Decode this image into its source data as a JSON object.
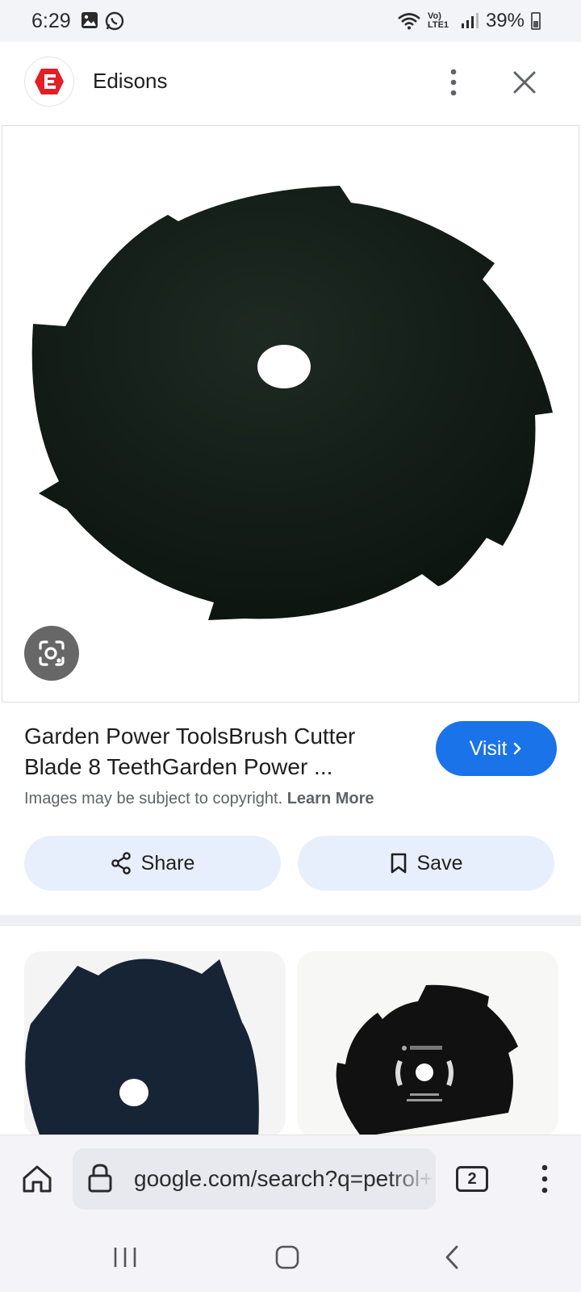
{
  "status_bar": {
    "time": "6:29",
    "network": "Vo) LTE1",
    "battery": "39%"
  },
  "header": {
    "site_name": "Edisons",
    "logo_color": "#e41e26"
  },
  "result": {
    "title": "Garden Power ToolsBrush Cutter Blade 8 TeethGarden Power ...",
    "visit_label": "Visit",
    "copyright_text": "Images may be subject to copyright.",
    "learn_more": "Learn More",
    "share_label": "Share",
    "save_label": "Save"
  },
  "browser": {
    "url": "google.com/search?q=petrol+",
    "tab_count": "2"
  },
  "colors": {
    "accent": "#1a73e8",
    "action_bg": "#e8effc"
  }
}
